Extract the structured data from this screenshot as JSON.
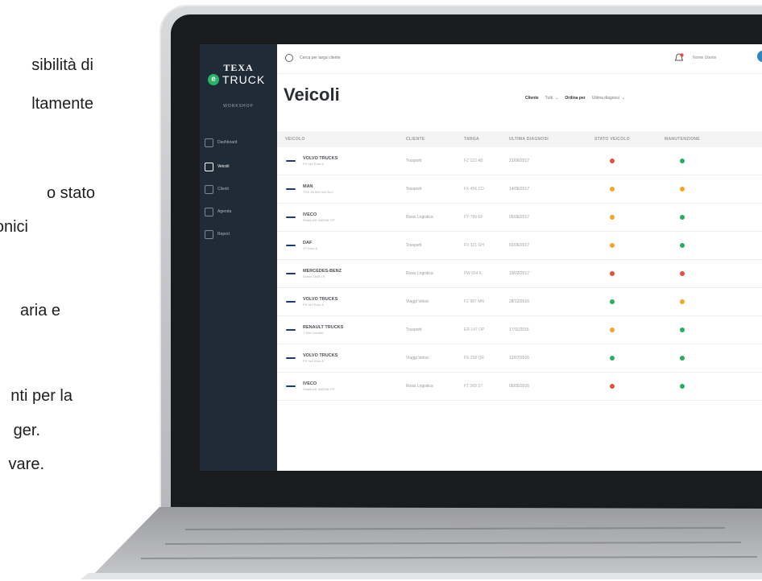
{
  "marketing_fragments": [
    "sibilità di",
    "ltamente",
    "o stato",
    "onici",
    "aria e",
    "nti per la",
    "ger.",
    "vare."
  ],
  "app": {
    "brand": {
      "texa": "TEXA",
      "e": "e",
      "truck": "TRUCK",
      "mode": "WORKSHOP"
    },
    "nav": [
      {
        "label": "Dashboard",
        "icon": "dashboard-icon"
      },
      {
        "label": "Veicoli",
        "icon": "truck-icon",
        "active": true
      },
      {
        "label": "Clienti",
        "icon": "user-icon"
      },
      {
        "label": "Agenda",
        "icon": "calendar-icon"
      },
      {
        "label": "Report",
        "icon": "chart-icon"
      }
    ],
    "search_placeholder": "Cerca per targa cliente",
    "user_name": "Nome Utente",
    "page_title": "Veicoli",
    "filters": {
      "cliente_label": "Cliente",
      "cliente_value": "Tutti",
      "order_label": "Ordina per",
      "order_value": "Ultima diagnosi"
    },
    "columns": [
      "VEICOLO",
      "CLIENTE",
      "TARGA",
      "ULTIMA DIAGNOSI",
      "STATO VEICOLO",
      "MANUTENZIONE"
    ],
    "status_colors": {
      "red": "#e74c3c",
      "orange": "#f5a623",
      "green": "#27ae60"
    },
    "rows": [
      {
        "make": "VOLVO TRUCKS",
        "model": "FH 4x2 Euro 6",
        "logo": "volvo",
        "cliente": "Trasporti",
        "targa": "FZ 123 AB",
        "diag": "21/06/2017",
        "stato": "red",
        "manut": "green"
      },
      {
        "make": "MAN",
        "model": "TGX 18.500 4x2 BLS",
        "logo": "man",
        "cliente": "Trasporti",
        "targa": "FX 456 CD",
        "diag": "14/06/2017",
        "stato": "orange",
        "manut": "orange"
      },
      {
        "make": "IVECO",
        "model": "Stralis AS 440S48 T/P",
        "logo": "iveco",
        "cliente": "Rossi Logistica",
        "targa": "FY 789 EF",
        "diag": "05/06/2017",
        "stato": "orange",
        "manut": "green"
      },
      {
        "make": "DAF",
        "model": "XF Euro 6",
        "logo": "daf",
        "cliente": "Trasporti",
        "targa": "FV 321 GH",
        "diag": "02/06/2017",
        "stato": "orange",
        "manut": "green"
      },
      {
        "make": "MERCEDES-BENZ",
        "model": "Actros 1845 LS",
        "logo": "mercedes",
        "cliente": "Rossi Logistica",
        "targa": "FW 654 IL",
        "diag": "19/03/2017",
        "stato": "red",
        "manut": "red"
      },
      {
        "make": "VOLVO TRUCKS",
        "model": "FH 4x2 Euro 6",
        "logo": "volvo",
        "cliente": "Viaggi Veloci",
        "targa": "FZ 987 MN",
        "diag": "28/12/2016",
        "stato": "green",
        "manut": "orange"
      },
      {
        "make": "RENAULT TRUCKS",
        "model": "T 520 Comfort",
        "logo": "renault",
        "cliente": "Trasporti",
        "targa": "ER 147 OP",
        "diag": "17/11/2016",
        "stato": "orange",
        "manut": "green"
      },
      {
        "make": "VOLVO TRUCKS",
        "model": "FH 4x2 Euro 6",
        "logo": "volvo",
        "cliente": "Viaggi Veloci",
        "targa": "FS 258 QR",
        "diag": "12/07/2016",
        "stato": "green",
        "manut": "green"
      },
      {
        "make": "IVECO",
        "model": "Stralis AS 440S46 T/P",
        "logo": "iveco",
        "cliente": "Rossi Logistica",
        "targa": "FT 369 ST",
        "diag": "06/05/2016",
        "stato": "red",
        "manut": "green"
      }
    ]
  }
}
